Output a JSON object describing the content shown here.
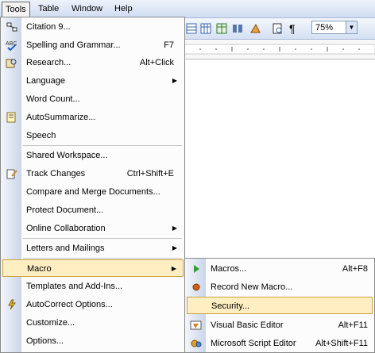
{
  "menubar": {
    "items": [
      {
        "label": "Tools"
      },
      {
        "label": "Table"
      },
      {
        "label": "Window"
      },
      {
        "label": "Help"
      }
    ]
  },
  "toolbar": {
    "zoom": "75%"
  },
  "tools_menu": {
    "items": [
      {
        "label": "Citation 9...",
        "shortcut": ""
      },
      {
        "label": "Spelling and Grammar...",
        "shortcut": "F7"
      },
      {
        "label": "Research...",
        "shortcut": "Alt+Click"
      },
      {
        "label": "Language",
        "shortcut": ""
      },
      {
        "label": "Word Count...",
        "shortcut": ""
      },
      {
        "label": "AutoSummarize...",
        "shortcut": ""
      },
      {
        "label": "Speech",
        "shortcut": ""
      },
      {
        "label": "Shared Workspace...",
        "shortcut": ""
      },
      {
        "label": "Track Changes",
        "shortcut": "Ctrl+Shift+E"
      },
      {
        "label": "Compare and Merge Documents...",
        "shortcut": ""
      },
      {
        "label": "Protect Document...",
        "shortcut": ""
      },
      {
        "label": "Online Collaboration",
        "shortcut": ""
      },
      {
        "label": "Letters and Mailings",
        "shortcut": ""
      },
      {
        "label": "Macro",
        "shortcut": ""
      },
      {
        "label": "Templates and Add-Ins...",
        "shortcut": ""
      },
      {
        "label": "AutoCorrect Options...",
        "shortcut": ""
      },
      {
        "label": "Customize...",
        "shortcut": ""
      },
      {
        "label": "Options...",
        "shortcut": ""
      }
    ]
  },
  "macro_menu": {
    "items": [
      {
        "label": "Macros...",
        "shortcut": "Alt+F8"
      },
      {
        "label": "Record New Macro...",
        "shortcut": ""
      },
      {
        "label": "Security...",
        "shortcut": ""
      },
      {
        "label": "Visual Basic Editor",
        "shortcut": "Alt+F11"
      },
      {
        "label": "Microsoft Script Editor",
        "shortcut": "Alt+Shift+F11"
      }
    ]
  },
  "colors": {
    "highlight": "#ffeec2",
    "highlight_border": "#c9a23e",
    "menubar": "#cfdcf1"
  }
}
